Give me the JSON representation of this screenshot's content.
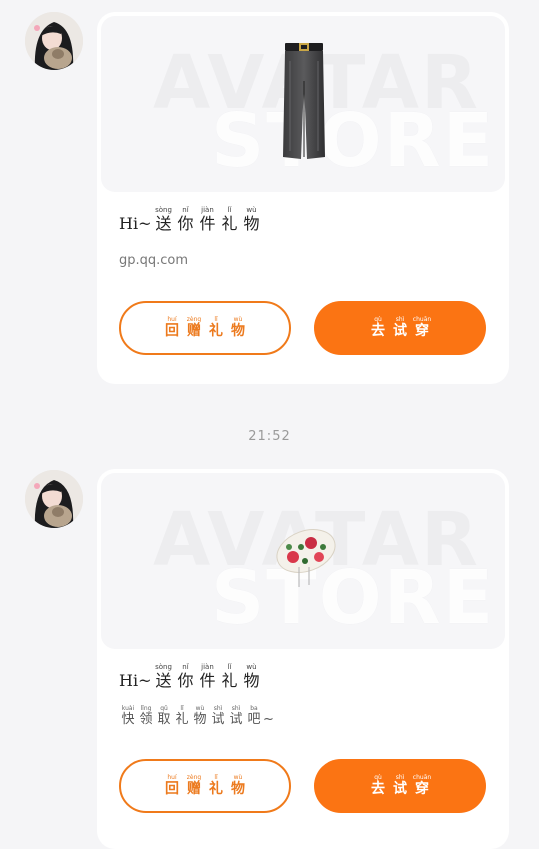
{
  "messages": [
    {
      "title_lead": "Hi~",
      "title": [
        {
          "hz": "送",
          "py": "sòng"
        },
        {
          "hz": "你",
          "py": "nǐ"
        },
        {
          "hz": "件",
          "py": "jiàn"
        },
        {
          "hz": "礼",
          "py": "lǐ"
        },
        {
          "hz": "物",
          "py": "wù"
        }
      ],
      "subtitle_text": "gp.qq.com",
      "watermark": [
        "AVATAR",
        "STORE"
      ],
      "item": "pants",
      "return_button": [
        {
          "hz": "回",
          "py": "huí"
        },
        {
          "hz": "赠",
          "py": "zèng"
        },
        {
          "hz": "礼",
          "py": "lǐ"
        },
        {
          "hz": "物",
          "py": "wù"
        }
      ],
      "try_button": [
        {
          "hz": "去",
          "py": "qù"
        },
        {
          "hz": "试",
          "py": "shì"
        },
        {
          "hz": "穿",
          "py": "chuān"
        }
      ]
    },
    {
      "title_lead": "Hi~",
      "title": [
        {
          "hz": "送",
          "py": "sòng"
        },
        {
          "hz": "你",
          "py": "nǐ"
        },
        {
          "hz": "件",
          "py": "jiàn"
        },
        {
          "hz": "礼",
          "py": "lǐ"
        },
        {
          "hz": "物",
          "py": "wù"
        }
      ],
      "subtitle_ruby": [
        {
          "hz": "快",
          "py": "kuài"
        },
        {
          "hz": "领",
          "py": "lǐng"
        },
        {
          "hz": "取",
          "py": "qǔ"
        },
        {
          "hz": "礼",
          "py": "lǐ"
        },
        {
          "hz": "物",
          "py": "wù"
        },
        {
          "hz": "试",
          "py": "shì"
        },
        {
          "hz": "试",
          "py": "shì"
        },
        {
          "hz": "吧",
          "py": "ba"
        }
      ],
      "subtitle_tail": "~",
      "watermark": [
        "AVATAR",
        "STORE"
      ],
      "item": "floral-hat",
      "return_button": [
        {
          "hz": "回",
          "py": "huí"
        },
        {
          "hz": "赠",
          "py": "zèng"
        },
        {
          "hz": "礼",
          "py": "lǐ"
        },
        {
          "hz": "物",
          "py": "wù"
        }
      ],
      "try_button": [
        {
          "hz": "去",
          "py": "qù"
        },
        {
          "hz": "试",
          "py": "shì"
        },
        {
          "hz": "穿",
          "py": "chuān"
        }
      ]
    }
  ],
  "timestamp": "21:52",
  "colors": {
    "accent": "#fb7413",
    "outline": "#ec7a1e",
    "background": "#f5f5f7"
  },
  "icons": [
    "user-avatar",
    "pants-item-image",
    "floral-hat-item-image"
  ]
}
